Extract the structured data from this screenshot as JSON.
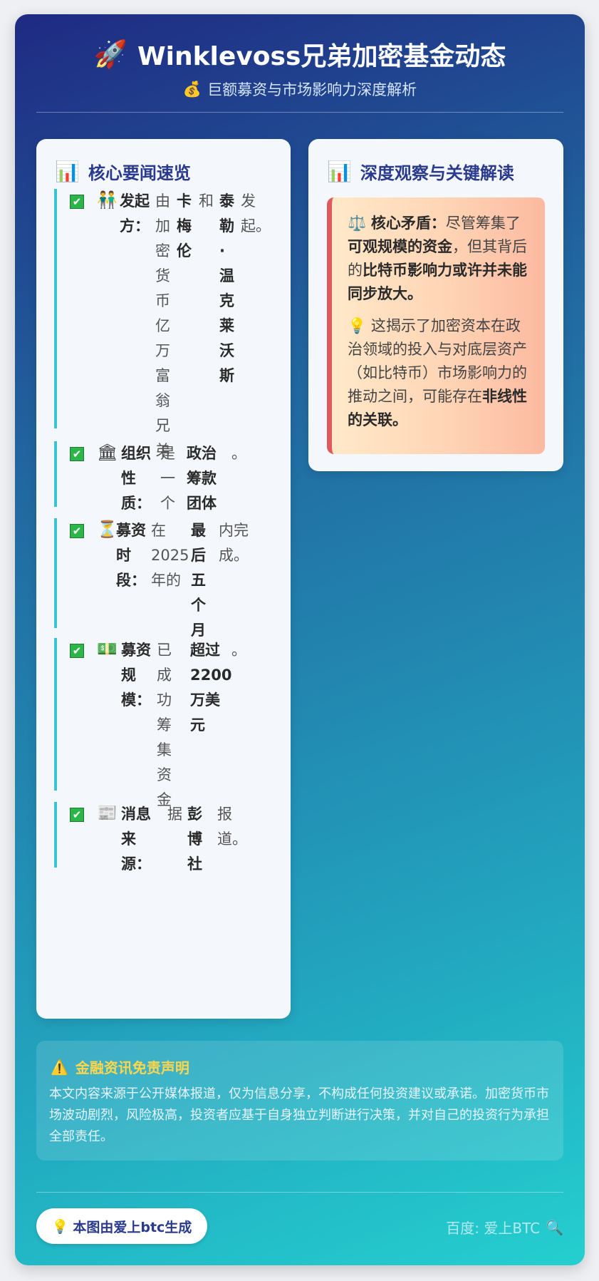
{
  "header": {
    "rocket_icon": "🚀",
    "title": "Winklevoss兄弟加密基金动态",
    "money_icon": "💰",
    "subtitle": "巨额募资与市场影响力深度解析"
  },
  "left_card": {
    "icon": "📊",
    "title": "核心要闻速览",
    "check_icon": "✔",
    "items": [
      {
        "emoji": "👬",
        "label": [
          "发起",
          "方："
        ],
        "text1": [
          "由",
          "加",
          "密",
          "货",
          "币",
          "亿",
          "万",
          "富",
          "翁",
          "兄",
          "弟"
        ],
        "bold1": [
          "卡",
          "梅",
          "伦"
        ],
        "text2": [
          "和"
        ],
        "bold2": [
          "泰",
          "勒",
          "·",
          "温",
          "克",
          "莱",
          "沃",
          "斯"
        ],
        "text3": [
          "发",
          "起。"
        ]
      },
      {
        "emoji": "🏛",
        "label": [
          "组织",
          "性",
          "质："
        ],
        "text1": [
          "是",
          "一",
          "个"
        ],
        "bold1": [
          "政治",
          "筹款",
          "团体"
        ],
        "text2": [
          "。"
        ]
      },
      {
        "emoji": "⏳",
        "label": [
          "募资",
          "时",
          "段："
        ],
        "text1": [
          "在",
          "2025",
          "年的"
        ],
        "bold1": [
          "最",
          "后",
          "五",
          "个",
          "月"
        ],
        "text2": [
          "内完",
          "成。"
        ]
      },
      {
        "emoji": "💵",
        "label": [
          "募资",
          "规",
          "模："
        ],
        "text1": [
          "已",
          "成",
          "功",
          "筹",
          "集",
          "资",
          "金"
        ],
        "bold1": [
          "超过",
          "2200",
          "万美",
          "元"
        ],
        "text2": [
          "。"
        ]
      },
      {
        "emoji": "📰",
        "label": [
          "消息",
          "来",
          "源："
        ],
        "text1": [
          "据"
        ],
        "bold1": [
          "彭",
          "博",
          "社"
        ],
        "text2": [
          "报",
          "道。"
        ]
      }
    ]
  },
  "right_card": {
    "icon": "📊",
    "title": "深度观察与关键解读",
    "p1_icon": "⚖️",
    "p1_label": "核心矛盾：",
    "p1_t1": "尽管筹集了",
    "p1_b1": "可观规模的资金",
    "p1_t2": "，但其背后的",
    "p1_b2": "比特币影响力或许并未能同步放大。",
    "p2_icon": "💡",
    "p2_t1": "这揭示了加密资本在政治领域的投入与对底层资产（如比特币）市场影响力的推动之间，可能存在",
    "p2_b1": "非线性的关联。"
  },
  "disclaimer": {
    "icon": "⚠️",
    "title": "金融资讯免责声明",
    "text": "本文内容来源于公开媒体报道，仅为信息分享，不构成任何投资建议或承诺。加密货币市场波动剧烈，风险极高，投资者应基于自身独立判断进行决策，并对自己的投资行为承担全部责任。"
  },
  "footer": {
    "bulb_icon": "💡",
    "made_by": "本图由爱上btc生成",
    "baidu_text": "百度: 爱上BTC",
    "search_icon": "🔍"
  }
}
